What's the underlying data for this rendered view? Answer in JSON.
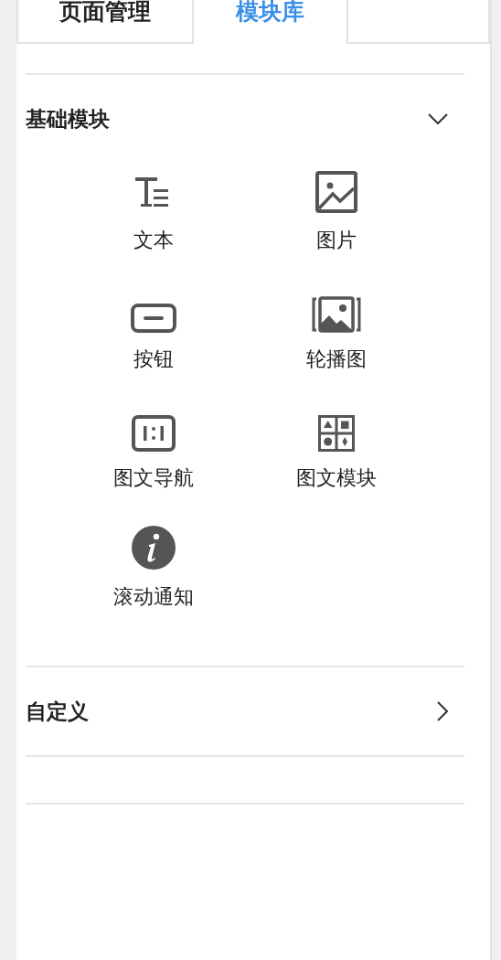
{
  "tabs": [
    {
      "label": "页面管理",
      "selected": false
    },
    {
      "label": "模块库",
      "selected": true
    }
  ],
  "sections": [
    {
      "title": "基础模块",
      "expanded": true,
      "items": [
        {
          "label": "文本",
          "kind": "text"
        },
        {
          "label": "图片",
          "kind": "image"
        },
        {
          "label": "按钮",
          "kind": "button"
        },
        {
          "label": "轮播图",
          "kind": "carousel"
        },
        {
          "label": "图文导航",
          "kind": "nav"
        },
        {
          "label": "图文模块",
          "kind": "grid"
        },
        {
          "label": "滚动通知",
          "kind": "notice"
        }
      ]
    },
    {
      "title": "自定义",
      "expanded": false
    }
  ]
}
